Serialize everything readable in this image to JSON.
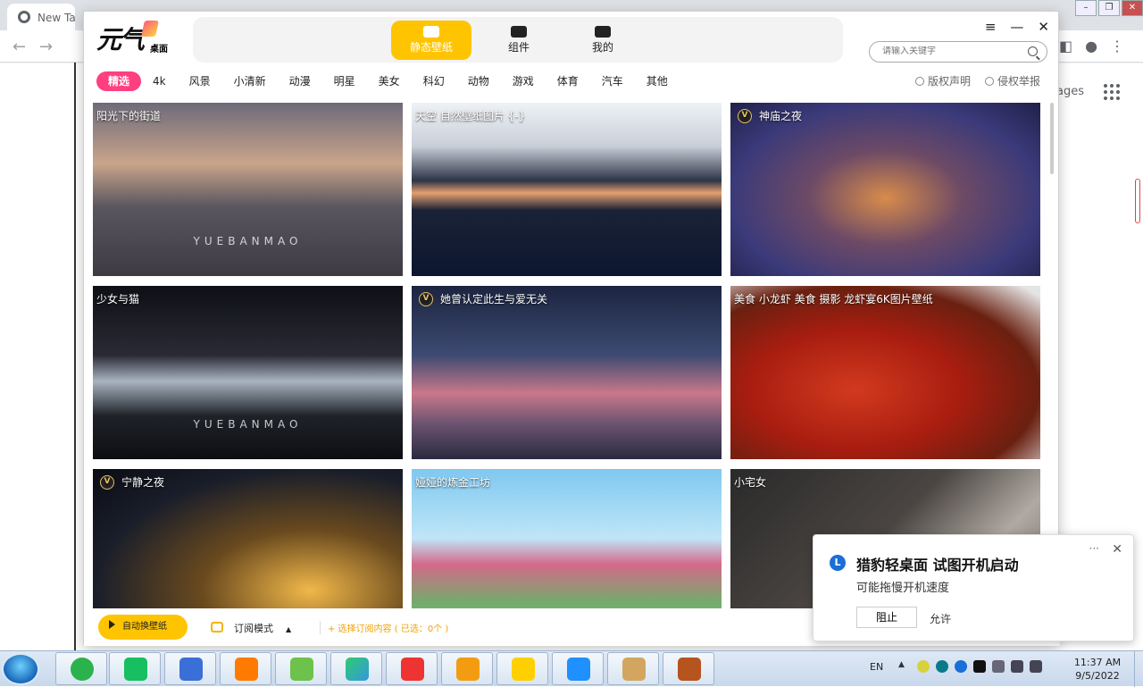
{
  "browser": {
    "tab_title": "New Ta",
    "images_link": "ages"
  },
  "app": {
    "logo_main": "元气",
    "logo_sub": "桌面",
    "top_nav": [
      {
        "label": "静态壁纸",
        "active": true
      },
      {
        "label": "组件",
        "active": false
      },
      {
        "label": "我的",
        "active": false
      }
    ],
    "search_placeholder": "请输入关键字",
    "categories": [
      "精选",
      "4k",
      "风景",
      "小清新",
      "动漫",
      "明星",
      "美女",
      "科幻",
      "动物",
      "游戏",
      "体育",
      "汽车",
      "其他"
    ],
    "active_category": "精选",
    "copyright_label": "版权声明",
    "report_label": "侵权举报",
    "wallpapers": [
      {
        "title": "阳光下的街道",
        "vip": false,
        "watermark": "YUEBANMAO"
      },
      {
        "title": "天空 自然壁纸图片 {-}",
        "vip": false,
        "watermark": ""
      },
      {
        "title": "神庙之夜",
        "vip": true,
        "watermark": ""
      },
      {
        "title": "少女与猫",
        "vip": false,
        "watermark": "YUEBANMAO"
      },
      {
        "title": "她曾认定此生与爱无关",
        "vip": true,
        "watermark": ""
      },
      {
        "title": "美食 小龙虾 美食 摄影 龙虾宴6K图片壁纸",
        "vip": false,
        "watermark": ""
      },
      {
        "title": "宁静之夜",
        "vip": true,
        "watermark": ""
      },
      {
        "title": "娅娅的炼金工坊",
        "vip": false,
        "watermark": ""
      },
      {
        "title": "小宅女",
        "vip": false,
        "watermark": ""
      }
    ],
    "bottom": {
      "auto_button": "自动换壁纸",
      "subscribe_mode": "订阅模式",
      "select_content": "+ 选择订阅内容 ( 已选：0个 )"
    }
  },
  "toast": {
    "title": "猎豹轻桌面 试图开机启动",
    "message": "可能拖慢开机速度",
    "block_button": "阻止",
    "allow_button": "允许"
  },
  "taskbar": {
    "language": "EN",
    "time": "11:37 AM",
    "date": "9/5/2022"
  },
  "colors": {
    "accent_yellow": "#ffc400",
    "category_pink": "#ff3f7f"
  }
}
